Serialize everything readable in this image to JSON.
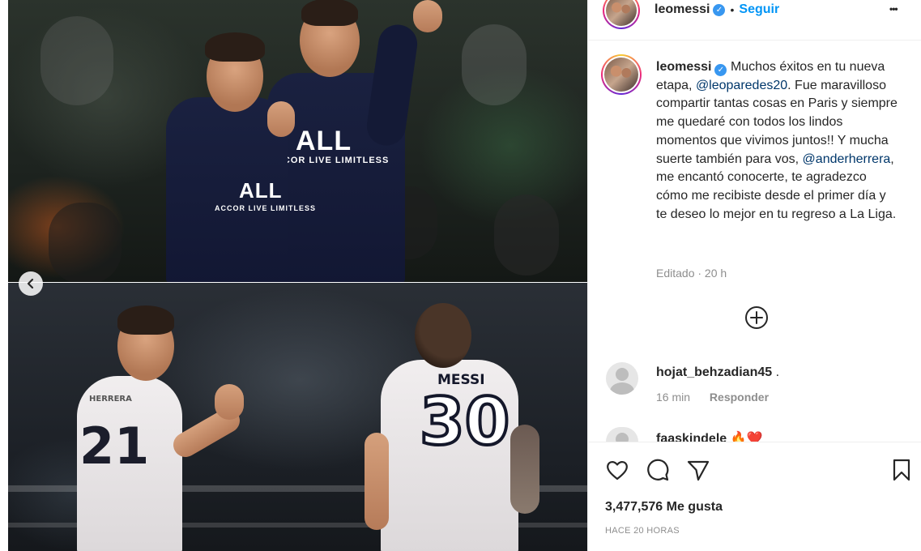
{
  "header": {
    "username": "leomessi",
    "separator": "•",
    "follow_label": "Seguir",
    "more_label": "•••"
  },
  "caption": {
    "username": "leomessi",
    "text_1": "Muchos éxitos en tu nueva etapa, ",
    "mention_1": "@leoparedes20",
    "text_2": ". Fue maravilloso compartir tantas cosas en Paris y siempre me quedaré con todos los lindos momentos que vivimos juntos!! Y mucha suerte también para vos, ",
    "mention_2": "@anderherrera",
    "text_3": ", me encantó conocerte, te agradezco cómo me recibiste desde el primer día y te deseo lo mejor en tu regreso a La Liga.",
    "meta": "Editado · 20 h"
  },
  "comments": [
    {
      "username": "hojat_behzadian45",
      "text": " .",
      "time": "16 min",
      "reply_label": "Responder"
    },
    {
      "username": "faaskindele",
      "text": "🔥❤️"
    }
  ],
  "photo": {
    "shirt_sponsor_top": "ALL",
    "shirt_sponsor_sub": "ACCOR LIVE LIMITLESS",
    "shirt_sponsor_top_2": "ALL",
    "shirt_sponsor_sub_2": "ACCOR LIVE LIMITLESS",
    "messi_name": "MESSI",
    "messi_number": "30",
    "herrera_name": "HERRERA",
    "herrera_number": "21"
  },
  "footer": {
    "likes": "3,477,576 Me gusta",
    "timestamp": "HACE 20 HORAS"
  },
  "icons": {
    "like": "heart-icon",
    "comment": "comment-icon",
    "share": "send-icon",
    "save": "bookmark-icon",
    "load_more": "plus-circle-icon",
    "prev": "chevron-left-icon"
  },
  "colors": {
    "link": "#0095f6",
    "mention": "#00376b",
    "muted": "#8e8e8e",
    "verified": "#3897f0"
  }
}
